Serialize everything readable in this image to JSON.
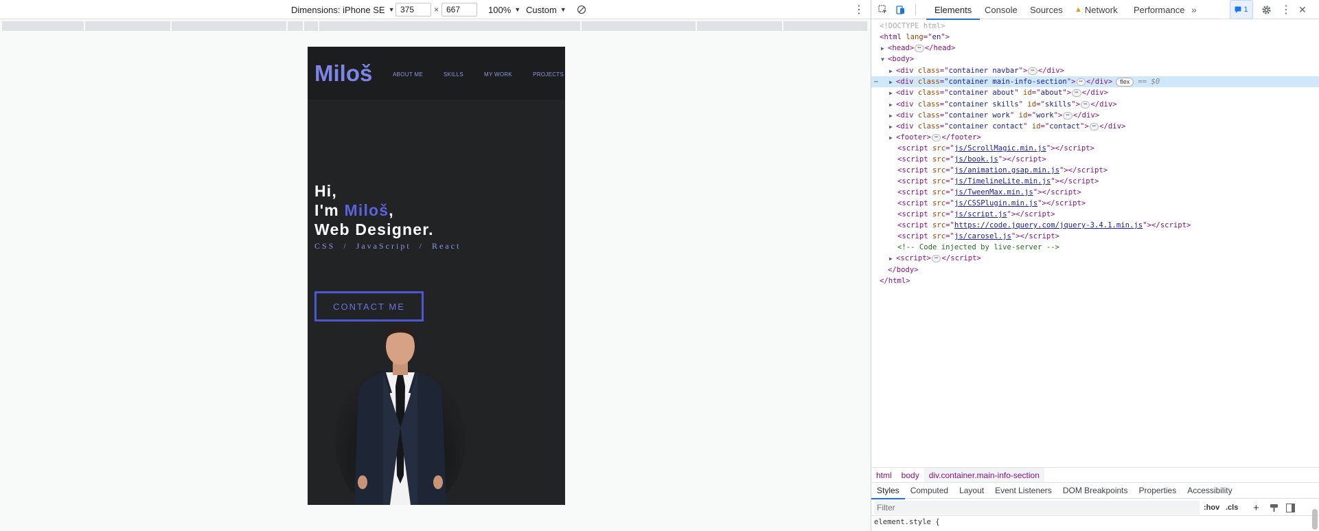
{
  "device_toolbar": {
    "dimensions_label": "Dimensions: iPhone SE",
    "width_value": "375",
    "height_value": "667",
    "times": "×",
    "zoom": "100%",
    "throttle": "Custom"
  },
  "site": {
    "logo": "Miloš",
    "nav": [
      "ABOUT ME",
      "SKILLS",
      "MY WORK",
      "PROJECTS"
    ],
    "hero_line1": "Hi,",
    "hero_line2_prefix": "I'm ",
    "hero_line2_name": "Miloš",
    "hero_line2_suffix": ",",
    "hero_line3": "Web Designer.",
    "stack": "CSS / JavaScript / React",
    "cta": "CONTACT ME"
  },
  "devtools": {
    "tabs": [
      "Elements",
      "Console",
      "Sources",
      "Network",
      "Performance"
    ],
    "more": "»",
    "issues_count": "1",
    "breadcrumbs": [
      "html",
      "body",
      "div.container.main-info-section"
    ],
    "sub_tabs": [
      "Styles",
      "Computed",
      "Layout",
      "Event Listeners",
      "DOM Breakpoints",
      "Properties",
      "Accessibility"
    ],
    "filter_placeholder": "Filter",
    "hov": ":hov",
    "cls": ".cls",
    "element_style": "element.style {",
    "flex_badge": "flex",
    "selected_marker": "== $0",
    "scripts": [
      "js/ScrollMagic.min.js",
      "js/book.js",
      "js/animation.gsap.min.js",
      "js/TimelineLite.min.js",
      "js/TweenMax.min.js",
      "js/CSSPlugin.min.js",
      "js/script.js",
      "https://code.jquery.com/jquery-3.4.1.min.js",
      "js/carosel.js"
    ],
    "comment": "<!-- Code injected by live-server -->"
  },
  "colors": {
    "accent": "#5a63dc",
    "page_bg": "#222325",
    "devtools_blue": "#1a73e8"
  }
}
